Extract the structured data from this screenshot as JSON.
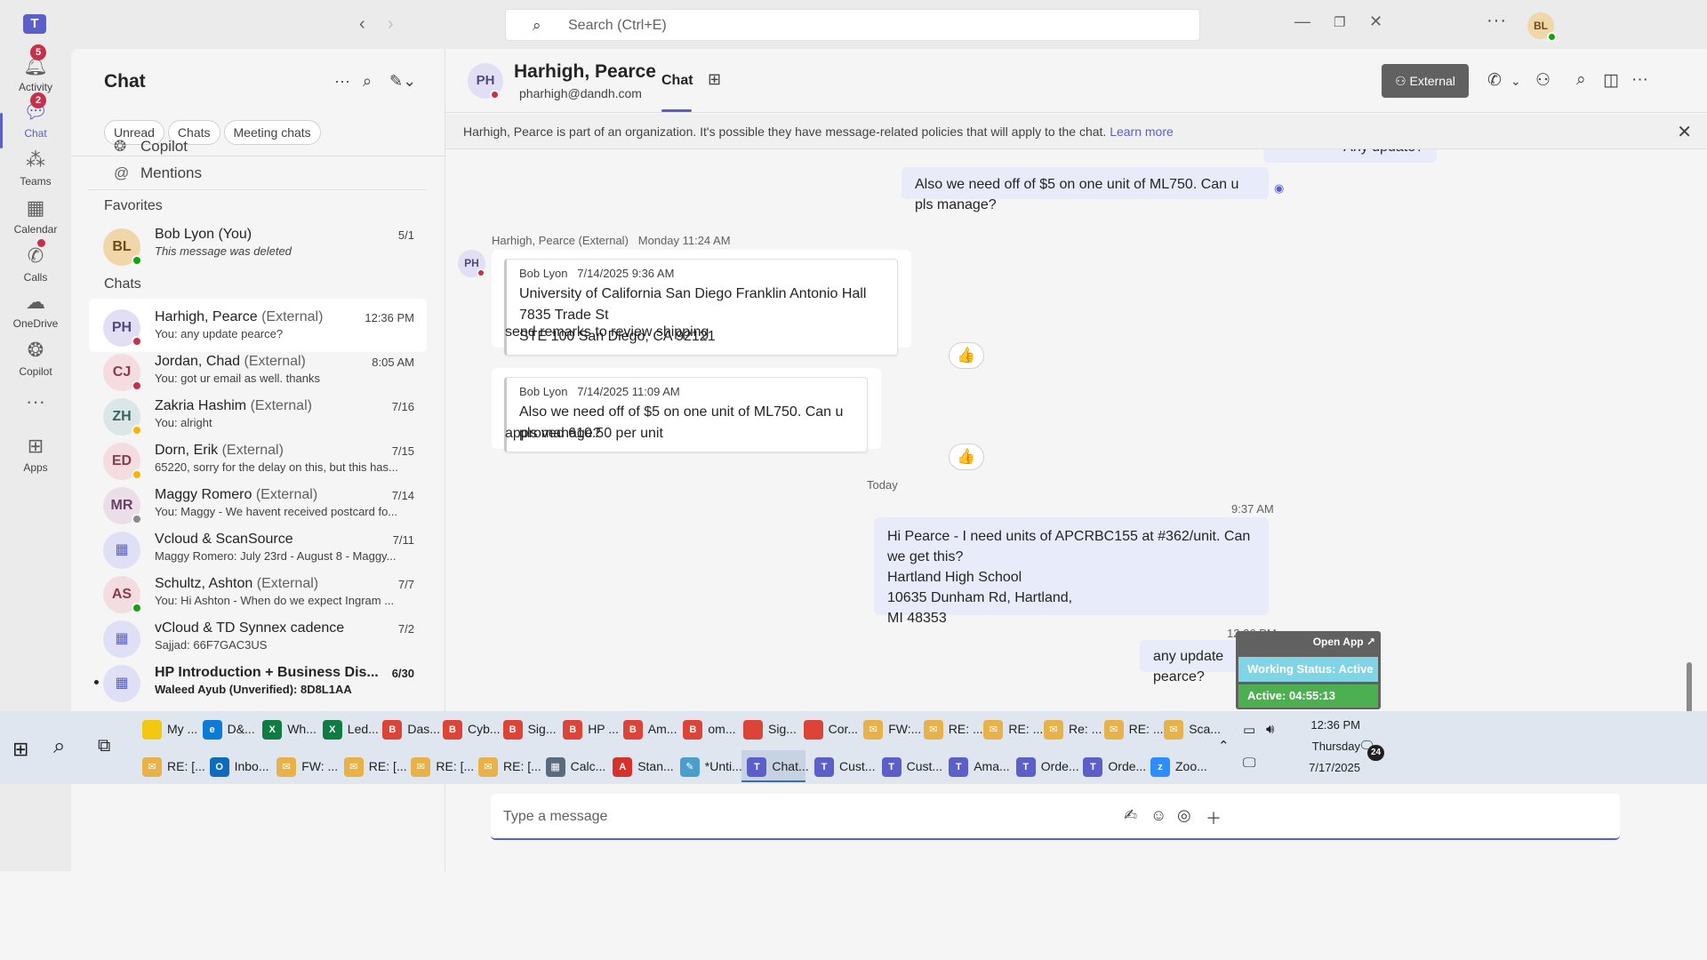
{
  "titlebar": {
    "search_placeholder": "Search (Ctrl+E)",
    "avatar_initials": "BL"
  },
  "rail": {
    "items": [
      {
        "label": "Activity",
        "badge": "5"
      },
      {
        "label": "Chat",
        "badge": "2"
      },
      {
        "label": "Teams"
      },
      {
        "label": "Calendar"
      },
      {
        "label": "Calls"
      },
      {
        "label": "OneDrive"
      },
      {
        "label": "Copilot"
      },
      {
        "label": "Apps"
      }
    ]
  },
  "list": {
    "title": "Chat",
    "filters": [
      "Unread",
      "Chats",
      "Meeting chats"
    ],
    "shortcuts": [
      "Copilot",
      "Mentions"
    ],
    "favorites_header": "Favorites",
    "chats_header": "Chats",
    "favorite": {
      "initials": "BL",
      "name": "Bob Lyon (You)",
      "preview": "This message was deleted",
      "time": "5/1"
    },
    "chats": [
      {
        "initials": "PH",
        "name": "Harhigh, Pearce",
        "ext": "(External)",
        "preview": "You: any update pearce?",
        "time": "12:36 PM",
        "avatar_bg": "#e2dff5",
        "avatar_fg": "#4f4a7d",
        "presence": "#c4314b"
      },
      {
        "initials": "CJ",
        "name": "Jordan, Chad",
        "ext": "(External)",
        "preview": "You: got ur email as well. thanks",
        "time": "8:05 AM",
        "avatar_bg": "#f4dde1",
        "avatar_fg": "#8a3a4a",
        "presence": "#c4314b"
      },
      {
        "initials": "ZH",
        "name": "Zakria Hashim",
        "ext": "(External)",
        "preview": "You: alright",
        "time": "7/16",
        "avatar_bg": "#dbe7e7",
        "avatar_fg": "#3a6262",
        "presence": "#f8b400"
      },
      {
        "initials": "ED",
        "name": "Dorn, Erik",
        "ext": "(External)",
        "preview": "65220, sorry for the delay on this, but this has...",
        "time": "7/15",
        "avatar_bg": "#f4dde1",
        "avatar_fg": "#8a3a4a",
        "presence": "#f8b400"
      },
      {
        "initials": "MR",
        "name": "Maggy Romero",
        "ext": "(External)",
        "preview": "You: Maggy - We havent received postcard fo...",
        "time": "7/14",
        "avatar_bg": "#eadfe8",
        "avatar_fg": "#6b3f66",
        "presence": "#8a8a8a"
      },
      {
        "initials": "",
        "name": "Vcloud & ScanSource",
        "ext": "",
        "preview": "Maggy Romero: July 23rd - August 8 - Maggy...",
        "time": "7/11",
        "avatar_bg": "#dfe0f5",
        "avatar_fg": "#5b5fc7",
        "presence": ""
      },
      {
        "initials": "AS",
        "name": "Schultz, Ashton",
        "ext": "(External)",
        "preview": "You: Hi Ashton -  When do we expect Ingram ...",
        "time": "7/7",
        "avatar_bg": "#f4dde1",
        "avatar_fg": "#8a3a4a",
        "presence": "#13a10e"
      },
      {
        "initials": "",
        "name": "vCloud & TD Synnex cadence",
        "ext": "",
        "preview": "Sajjad: 66F7GAC3US",
        "time": "7/2",
        "avatar_bg": "#dfe0f5",
        "avatar_fg": "#5b5fc7",
        "presence": ""
      },
      {
        "initials": "",
        "name": "HP Introduction + Business Dis...",
        "ext": "",
        "preview": "Waleed Ayub (Unverified): 8D8L1AA",
        "time": "6/30",
        "avatar_bg": "#dfe0f5",
        "avatar_fg": "#5b5fc7",
        "presence": "",
        "unread": true
      }
    ]
  },
  "header": {
    "initials": "PH",
    "name": "Harhigh, Pearce",
    "email": "pharhigh@dandh.com",
    "tab": "Chat",
    "external_label": "External"
  },
  "banner": {
    "text": "Harhigh, Pearce is part of an organization. It's possible they have message-related policies that will apply to the chat.",
    "link": "Learn more"
  },
  "messages": {
    "partial_top": "Any update?",
    "me_1": "Also we need off of $5 on one unit of ML750. Can u pls manage?",
    "them_meta": "Harhigh, Pearce (External)   Monday 11:24 AM",
    "them_initials": "PH",
    "quote1_author": "Bob Lyon   7/14/2025 9:36 AM",
    "quote1_line1": "University of California San Diego Franklin Antonio Hall 7835 Trade St",
    "quote1_line2": "STE 100 San Diego, CA 92121",
    "reply1": "send remarks to review shipping",
    "quote2_author": "Bob Lyon   7/14/2025 11:09 AM",
    "quote2_text": "Also we need off of $5 on one unit of ML750. Can u pls manage?",
    "reply2": "approved 610.50 per unit",
    "day_divider": "Today",
    "me_2_time": "9:37 AM",
    "me_2_lines": [
      "Hi Pearce -  I need units of APCRBC155 at #362/unit. Can we get this?",
      "Hartland High School",
      "10635 Dunham Rd, Hartland,",
      "MI 48353"
    ],
    "me_3_time": "12:36 PM",
    "me_3": "any update pearce?"
  },
  "compose": {
    "placeholder": "Type a message"
  },
  "widget": {
    "open_app": "Open App ↗",
    "status": "Working Status: Active",
    "active": "Active: 04:55:13"
  },
  "taskbar": {
    "row1": [
      {
        "label": "My ...",
        "color": "#f2c811",
        "glyph": ""
      },
      {
        "label": "D&...",
        "color": "#0c7bd6",
        "glyph": "e"
      },
      {
        "label": "Wh...",
        "color": "#107c41",
        "glyph": "X"
      },
      {
        "label": "Led...",
        "color": "#107c41",
        "glyph": "X"
      },
      {
        "label": "Das...",
        "color": "#db4437",
        "glyph": "B"
      },
      {
        "label": "Cyb...",
        "color": "#db4437",
        "glyph": "B"
      },
      {
        "label": "Sig...",
        "color": "#db4437",
        "glyph": "B"
      },
      {
        "label": "HP ...",
        "color": "#db4437",
        "glyph": "B"
      },
      {
        "label": "Am...",
        "color": "#db4437",
        "glyph": "B"
      },
      {
        "label": "om...",
        "color": "#db4437",
        "glyph": "B"
      },
      {
        "label": "Sig...",
        "color": "#db4437",
        "glyph": ""
      },
      {
        "label": "Cor...",
        "color": "#db4437",
        "glyph": ""
      },
      {
        "label": "FW:...",
        "color": "#e8b24a",
        "glyph": "✉"
      },
      {
        "label": "RE: ...",
        "color": "#e8b24a",
        "glyph": "✉"
      },
      {
        "label": "RE: ...",
        "color": "#e8b24a",
        "glyph": "✉"
      },
      {
        "label": "Re: ...",
        "color": "#e8b24a",
        "glyph": "✉"
      },
      {
        "label": "RE: ...",
        "color": "#e8b24a",
        "glyph": "✉"
      },
      {
        "label": "Sca...",
        "color": "#e8b24a",
        "glyph": "✉"
      }
    ],
    "row2": [
      {
        "label": "RE: [...",
        "color": "#e8b24a",
        "glyph": "✉"
      },
      {
        "label": "Inbo...",
        "color": "#0f6cbd",
        "glyph": "O"
      },
      {
        "label": "FW: ...",
        "color": "#e8b24a",
        "glyph": "✉"
      },
      {
        "label": "RE: [...",
        "color": "#e8b24a",
        "glyph": "✉"
      },
      {
        "label": "RE: [...",
        "color": "#e8b24a",
        "glyph": "✉"
      },
      {
        "label": "RE: [...",
        "color": "#e8b24a",
        "glyph": "✉"
      },
      {
        "label": "Calc...",
        "color": "#5a6b7d",
        "glyph": "▦"
      },
      {
        "label": "Stan...",
        "color": "#d6322c",
        "glyph": "A"
      },
      {
        "label": "*Unti...",
        "color": "#4a9ecb",
        "glyph": "✎"
      },
      {
        "label": "Chat...",
        "color": "#5b5fc7",
        "glyph": "T",
        "active": true
      },
      {
        "label": "Cust...",
        "color": "#5b5fc7",
        "glyph": "T"
      },
      {
        "label": "Cust...",
        "color": "#5b5fc7",
        "glyph": "T"
      },
      {
        "label": "Ama...",
        "color": "#5b5fc7",
        "glyph": "T"
      },
      {
        "label": "Orde...",
        "color": "#5b5fc7",
        "glyph": "T"
      },
      {
        "label": "Orde...",
        "color": "#5b5fc7",
        "glyph": "T"
      },
      {
        "label": "Zoo...",
        "color": "#2d8cff",
        "glyph": "z"
      }
    ],
    "time": "12:36 PM",
    "day": "Thursday",
    "date": "7/17/2025",
    "notif_count": "24"
  }
}
